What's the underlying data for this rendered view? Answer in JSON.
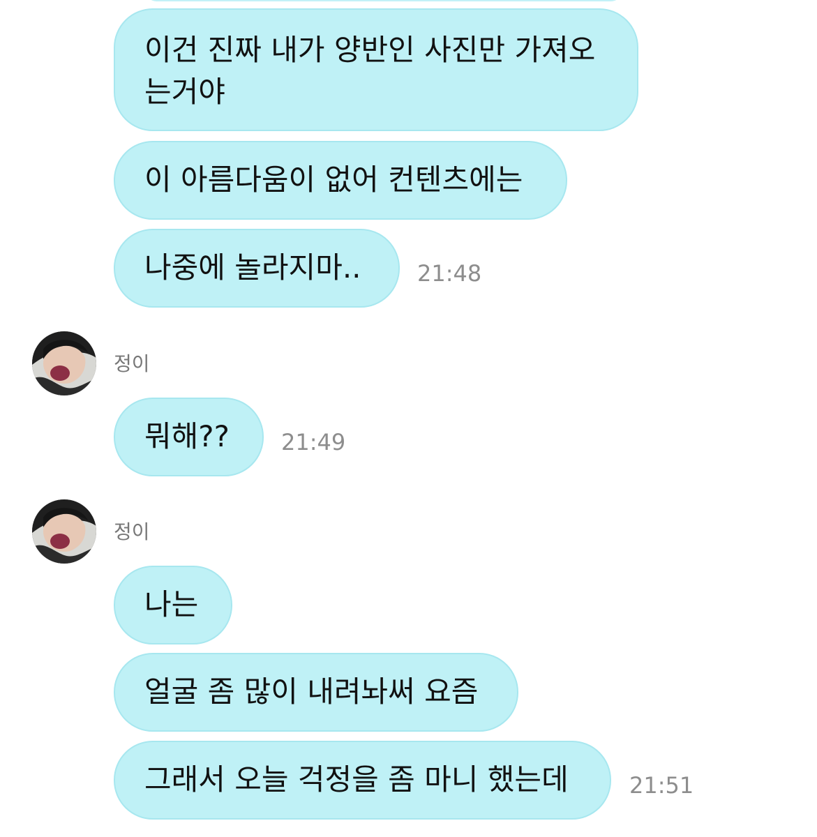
{
  "chat": {
    "messages_top": [
      {
        "text": "이건 진짜 내가 양반인 사진만 가져오\n는거야"
      },
      {
        "text": "이 아름다움이 없어 컨텐츠에는"
      },
      {
        "text": "나중에 놀라지마.."
      }
    ],
    "time_1": "21:48",
    "group_2": {
      "sender": "정이",
      "messages": [
        {
          "text": "뭐해??"
        }
      ],
      "time": "21:49"
    },
    "group_3": {
      "sender": "정이",
      "messages": [
        {
          "text": "나는"
        },
        {
          "text": "얼굴 좀 많이 내려놔써 요즘"
        },
        {
          "text": "그래서 오늘 걱정을 좀 마니 했는데"
        }
      ],
      "time": "21:51"
    }
  },
  "colors": {
    "bubble": "#bff1f6",
    "bubble_border": "#a7e7ef",
    "timestamp": "#8d8d8d",
    "sender": "#777777"
  },
  "icons": {
    "avatar": "profile-photo-avatar"
  }
}
